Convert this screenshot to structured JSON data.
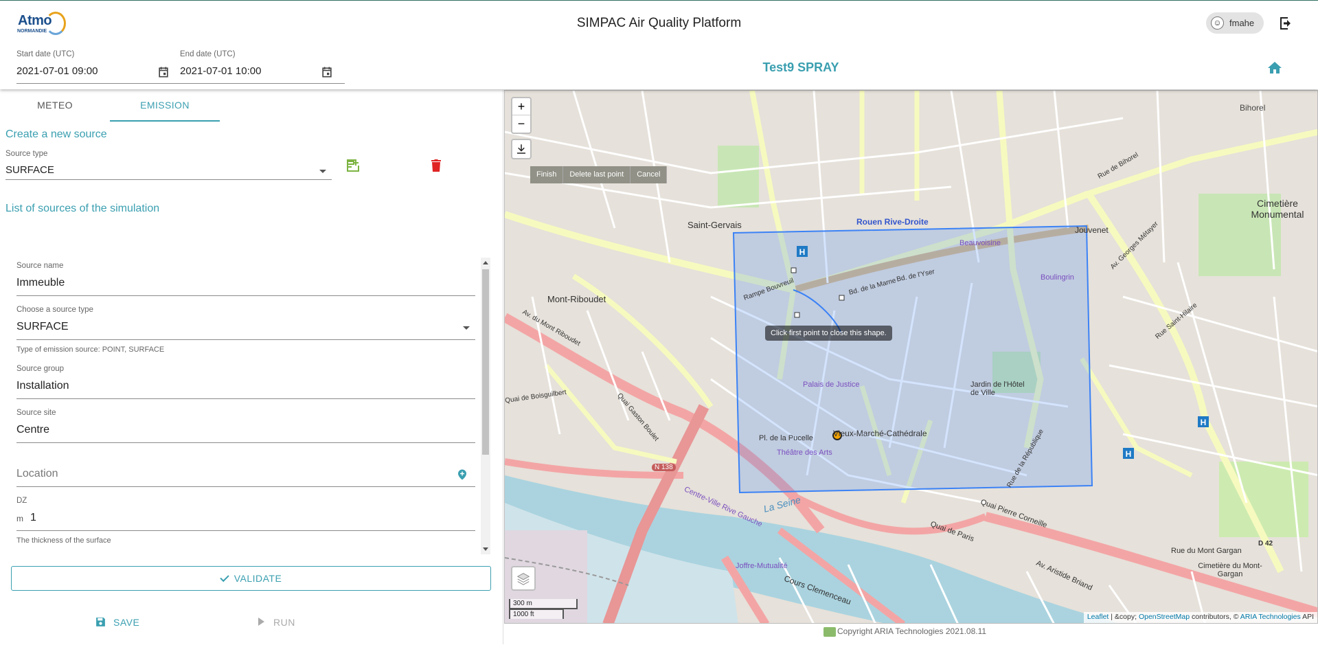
{
  "header": {
    "app_title": "SIMPAC Air Quality Platform",
    "logo": {
      "text": "Atmo",
      "subtext": "NORMANDIE"
    },
    "user": {
      "name": "fmahe"
    },
    "simulation_title": "Test9 SPRAY",
    "start_date": {
      "label": "Start date (UTC)",
      "value": "2021-07-01 09:00"
    },
    "end_date": {
      "label": "End date (UTC)",
      "value": "2021-07-01 10:00"
    }
  },
  "tabs": [
    {
      "label": "METEO",
      "active": false
    },
    {
      "label": "EMISSION",
      "active": true
    }
  ],
  "emission": {
    "new_source_title": "Create a new source",
    "source_type": {
      "label": "Source type",
      "value": "SURFACE"
    },
    "list_title": "List of sources of the simulation",
    "form": {
      "source_name": {
        "label": "Source name",
        "value": "Immeuble"
      },
      "source_type": {
        "label": "Choose a source type",
        "value": "SURFACE",
        "hint": "Type of emission source: POINT, SURFACE"
      },
      "source_group": {
        "label": "Source group",
        "value": "Installation"
      },
      "source_site": {
        "label": "Source site",
        "value": "Centre"
      },
      "location": {
        "placeholder": "Location"
      },
      "dz": {
        "label": "DZ",
        "unit": "m",
        "value": "1",
        "hint": "The thickness of the surface"
      }
    },
    "validate_label": "VALIDATE",
    "save_label": "SAVE",
    "run_label": "RUN"
  },
  "map": {
    "zoom_in": "+",
    "zoom_out": "−",
    "draw_actions": [
      "Finish",
      "Delete last point",
      "Cancel"
    ],
    "tooltip": "Click first point to close this shape.",
    "scale_metric": "300 m",
    "scale_imperial": "1000 ft",
    "attribution": {
      "leaflet": "Leaflet",
      "sep1": " | &copy; ",
      "osm": "OpenStreetMap",
      "contrib": " contributors, © ",
      "aria": "ARIA Technologies",
      "api": " API"
    },
    "labels": [
      "Saint-Gervais",
      "Rouen Rive-Droite",
      "Mont-Riboudet",
      "Beauvoisine",
      "Boulingrin",
      "Cimetière Monumental",
      "Jouvenet",
      "Bihorel",
      "Palais de Justice",
      "Jardin de l'Hôtel de Ville",
      "Vieux-Marché-Cathédrale",
      "Théâtre des Arts",
      "Pl. de la Pucelle",
      "Rue de la République",
      "Quai Pierre Corneille",
      "Quai de Paris",
      "Cours Clemenceau",
      "Centre-Ville Rive Gauche",
      "Joffre-Mutualité",
      "Cimetière du Mont-Gargan",
      "Rue du Mont Gargan",
      "Av. Aristide Briand",
      "N 138",
      "D 42",
      "Quai Gaston Boulet",
      "Quai de Boisguilbert",
      "Av. du Mont Riboudet",
      "Rue de Bihorel",
      "Av. Georges Métayer",
      "Rue Saint-Hilaire",
      "Rampe Bouvreuil",
      "Bd. de la Marne",
      "Bd. de l'Yser",
      "La Seine"
    ],
    "colors": {
      "polygon": "#3b82f6",
      "accent": "#3a9fb0"
    }
  },
  "footer": {
    "copyright": "Copyright ARIA Technologies 2021.08.11"
  }
}
